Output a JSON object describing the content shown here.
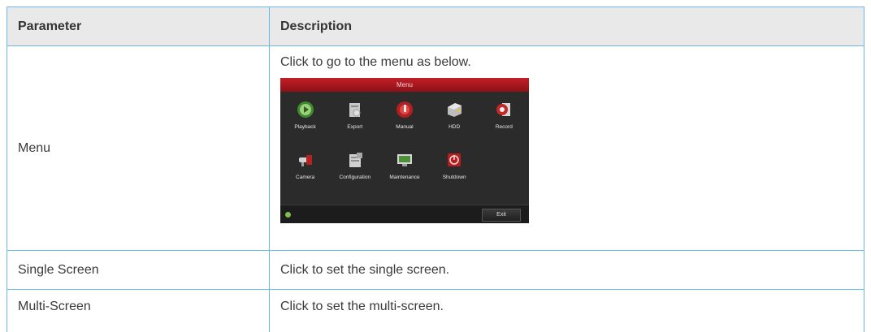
{
  "table": {
    "headers": {
      "param": "Parameter",
      "desc": "Description"
    },
    "rows": [
      {
        "param": "Menu",
        "desc": "Click to go to the menu as below."
      },
      {
        "param": "Single Screen",
        "desc": "Click to set the single screen."
      },
      {
        "param": "Multi-Screen",
        "desc": "Click to set the multi-screen."
      }
    ]
  },
  "menu_screenshot": {
    "title": "Menu",
    "items": [
      {
        "label": "Playback",
        "icon": "playback-icon"
      },
      {
        "label": "Export",
        "icon": "export-icon"
      },
      {
        "label": "Manual",
        "icon": "manual-icon"
      },
      {
        "label": "HDD",
        "icon": "hdd-icon"
      },
      {
        "label": "Record",
        "icon": "record-icon"
      },
      {
        "label": "Camera",
        "icon": "camera-icon"
      },
      {
        "label": "Configuration",
        "icon": "configuration-icon"
      },
      {
        "label": "Maintenance",
        "icon": "maintenance-icon"
      },
      {
        "label": "Shutdown",
        "icon": "shutdown-icon"
      }
    ],
    "exit_label": "Exit",
    "colors": {
      "titlebar": "#c21f28",
      "background": "#2b2b2b",
      "status": "#7cc04b"
    }
  },
  "colors": {
    "border": "#6fb7e6",
    "header_bg": "#e9e9e9"
  }
}
